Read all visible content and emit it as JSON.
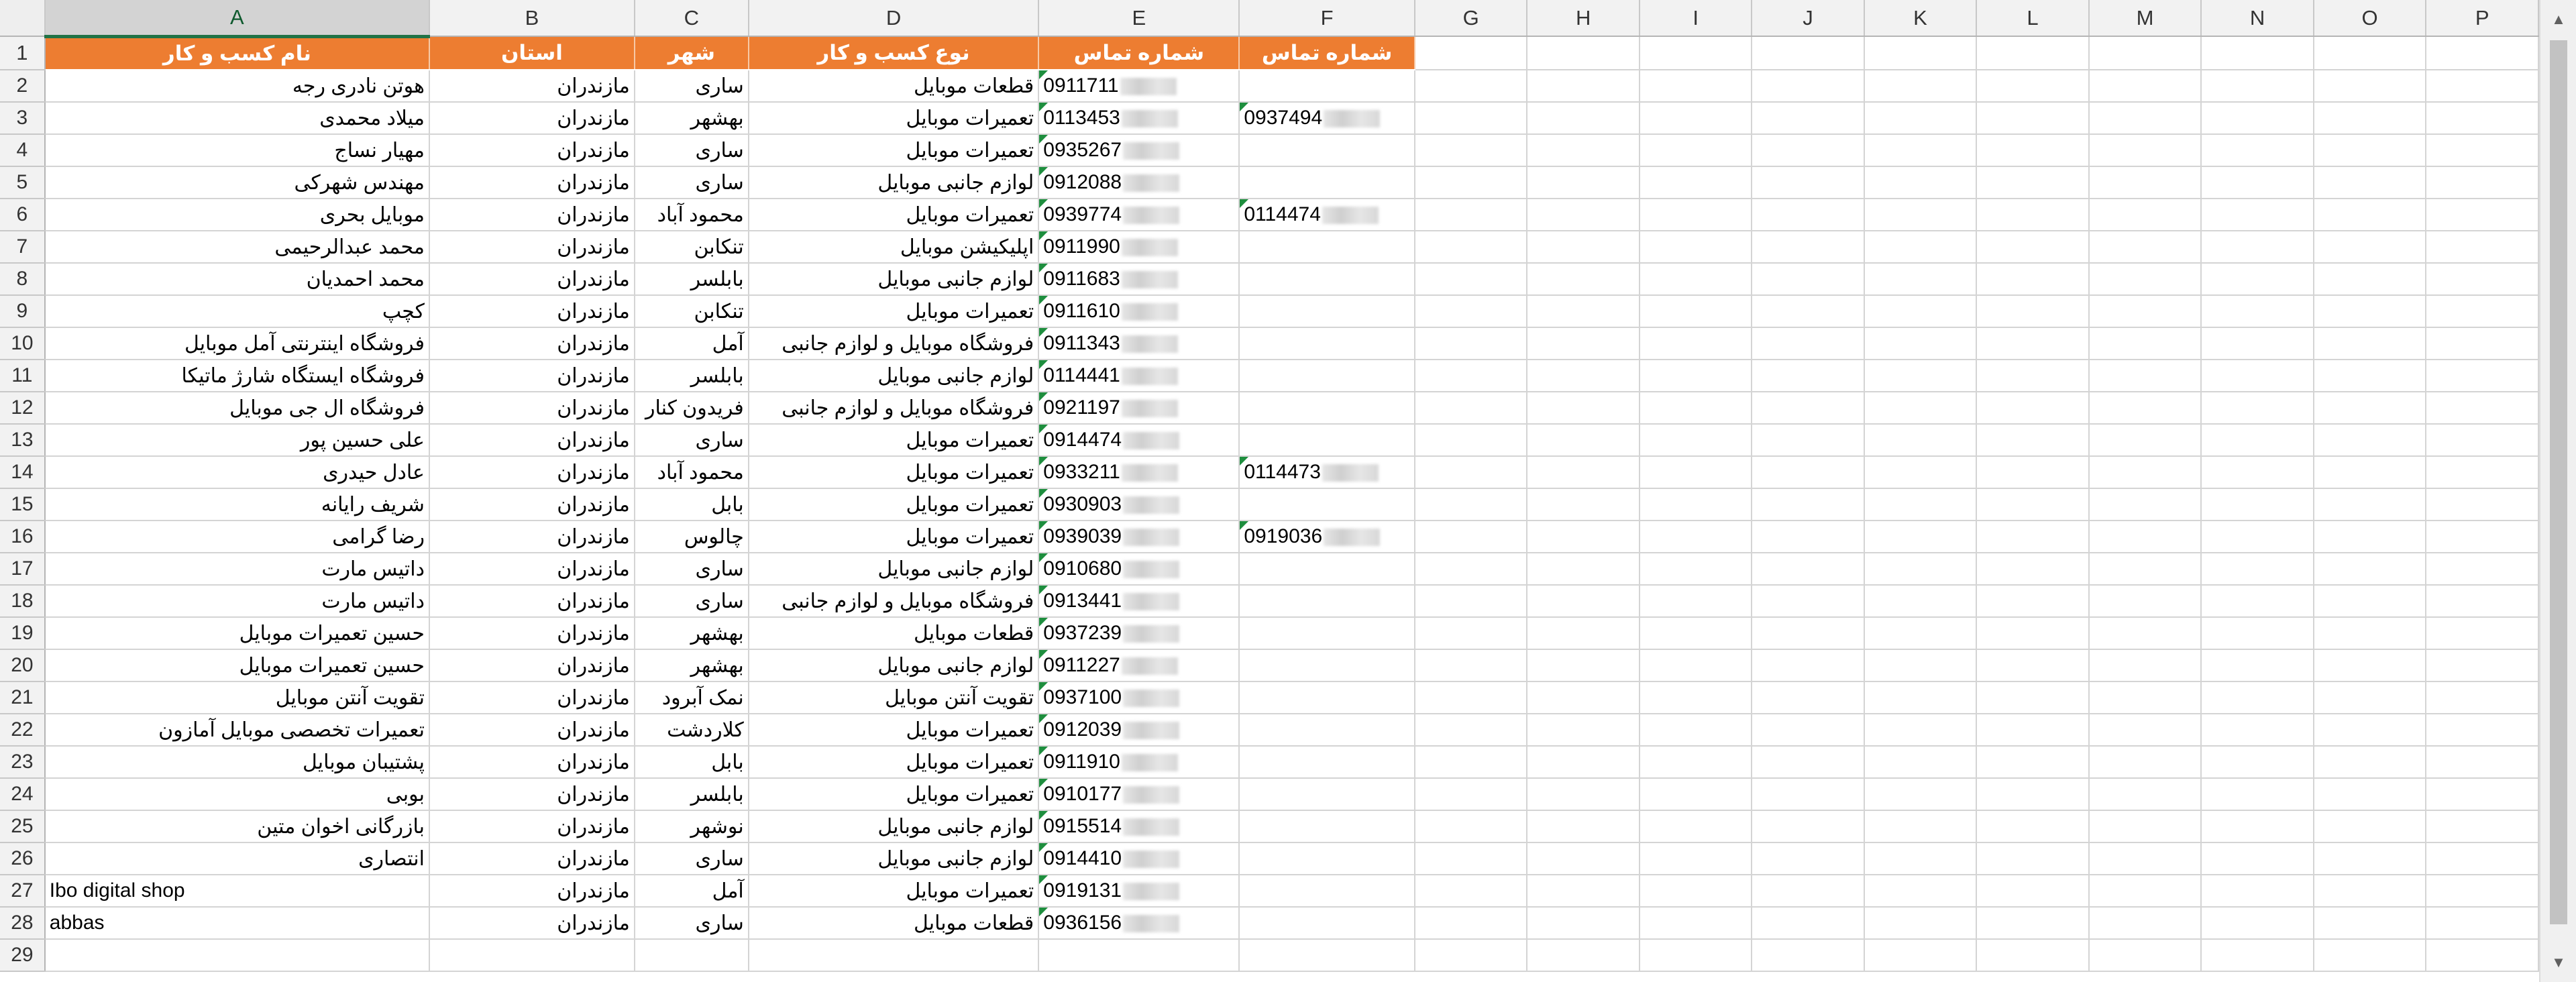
{
  "columns": [
    "A",
    "B",
    "C",
    "D",
    "E",
    "F",
    "G",
    "H",
    "I",
    "J",
    "K",
    "L",
    "M",
    "N",
    "O",
    "P"
  ],
  "selected_column": "A",
  "header_row": {
    "A": "نام کسب و کار",
    "B": "استان",
    "C": "شهر",
    "D": "نوع کسب و کار",
    "E": "شماره تماس",
    "F": "شماره تماس"
  },
  "rows": [
    {
      "n": "2",
      "name": "هوتن نادری رجه",
      "province": "مازندران",
      "city": "ساری",
      "type": "قطعات موبایل",
      "phone": "0911711",
      "phone2": ""
    },
    {
      "n": "3",
      "name": "میلاد محمدی",
      "province": "مازندران",
      "city": "بهشهر",
      "type": "تعمیرات موبایل",
      "phone": "0113453",
      "phone2": "0937494"
    },
    {
      "n": "4",
      "name": "مهیار نساج",
      "province": "مازندران",
      "city": "ساری",
      "type": "تعمیرات موبایل",
      "phone": "0935267",
      "phone2": ""
    },
    {
      "n": "5",
      "name": "مهندس شهرکی",
      "province": "مازندران",
      "city": "ساری",
      "type": "لوازم جانبی موبایل",
      "phone": "0912088",
      "phone2": ""
    },
    {
      "n": "6",
      "name": "موبایل بحری",
      "province": "مازندران",
      "city": "محمود آباد",
      "type": "تعمیرات موبایل",
      "phone": "0939774",
      "phone2": "0114474"
    },
    {
      "n": "7",
      "name": "محمد عبدالرحیمی",
      "province": "مازندران",
      "city": "تنکابن",
      "type": "اپلیکیشن موبایل",
      "phone": "0911990",
      "phone2": ""
    },
    {
      "n": "8",
      "name": "محمد احمدیان",
      "province": "مازندران",
      "city": "بابلسر",
      "type": "لوازم جانبی موبایل",
      "phone": "0911683",
      "phone2": ""
    },
    {
      "n": "9",
      "name": "کچپ",
      "province": "مازندران",
      "city": "تنکابن",
      "type": "تعمیرات موبایل",
      "phone": "0911610",
      "phone2": ""
    },
    {
      "n": "10",
      "name": "فروشگاه اینترنتی آمل موبایل",
      "province": "مازندران",
      "city": "آمل",
      "type": "فروشگاه موبایل و لوازم جانبی",
      "phone": "0911343",
      "phone2": ""
    },
    {
      "n": "11",
      "name": "فروشگاه ایستگاه شارژ ماتیکا",
      "province": "مازندران",
      "city": "بابلسر",
      "type": "لوازم جانبی موبایل",
      "phone": "0114441",
      "phone2": ""
    },
    {
      "n": "12",
      "name": "فروشگاه ال جی موبایل",
      "province": "مازندران",
      "city": "فریدون کنار",
      "type": "فروشگاه موبایل و لوازم جانبی",
      "phone": "0921197",
      "phone2": ""
    },
    {
      "n": "13",
      "name": "علی حسین پور",
      "province": "مازندران",
      "city": "ساری",
      "type": "تعمیرات موبایل",
      "phone": "0914474",
      "phone2": ""
    },
    {
      "n": "14",
      "name": "عادل حیدری",
      "province": "مازندران",
      "city": "محمود آباد",
      "type": "تعمیرات موبایل",
      "phone": "0933211",
      "phone2": "0114473"
    },
    {
      "n": "15",
      "name": "شریف رایانه",
      "province": "مازندران",
      "city": "بابل",
      "type": "تعمیرات موبایل",
      "phone": "0930903",
      "phone2": ""
    },
    {
      "n": "16",
      "name": "رضا گرامی",
      "province": "مازندران",
      "city": "چالوس",
      "type": "تعمیرات موبایل",
      "phone": "0939039",
      "phone2": "0919036"
    },
    {
      "n": "17",
      "name": "داتیس مارت",
      "province": "مازندران",
      "city": "ساری",
      "type": "لوازم جانبی موبایل",
      "phone": "0910680",
      "phone2": ""
    },
    {
      "n": "18",
      "name": "داتیس مارت",
      "province": "مازندران",
      "city": "ساری",
      "type": "فروشگاه موبایل و لوازم جانبی",
      "phone": "0913441",
      "phone2": ""
    },
    {
      "n": "19",
      "name": "حسین تعمیرات موبایل",
      "province": "مازندران",
      "city": "بهشهر",
      "type": "قطعات موبایل",
      "phone": "0937239",
      "phone2": ""
    },
    {
      "n": "20",
      "name": "حسین تعمیرات موبایل",
      "province": "مازندران",
      "city": "بهشهر",
      "type": "لوازم جانبی موبایل",
      "phone": "0911227",
      "phone2": ""
    },
    {
      "n": "21",
      "name": "تقویت آنتن موبایل",
      "province": "مازندران",
      "city": "نمک آبرود",
      "type": "تقویت آنتن موبایل",
      "phone": "0937100",
      "phone2": ""
    },
    {
      "n": "22",
      "name": "تعمیرات تخصصی موبایل آمازون",
      "province": "مازندران",
      "city": "کلاردشت",
      "type": "تعمیرات موبایل",
      "phone": "0912039",
      "phone2": ""
    },
    {
      "n": "23",
      "name": "پشتیبان موبایل",
      "province": "مازندران",
      "city": "بابل",
      "type": "تعمیرات موبایل",
      "phone": "0911910",
      "phone2": ""
    },
    {
      "n": "24",
      "name": "بوبی",
      "province": "مازندران",
      "city": "بابلسر",
      "type": "تعمیرات موبایل",
      "phone": "0910177",
      "phone2": ""
    },
    {
      "n": "25",
      "name": "بازرگانی اخوان متین",
      "province": "مازندران",
      "city": "نوشهر",
      "type": "لوازم جانبی موبایل",
      "phone": "0915514",
      "phone2": ""
    },
    {
      "n": "26",
      "name": "انتصاری",
      "province": "مازندران",
      "city": "ساری",
      "type": "لوازم جانبی موبایل",
      "phone": "0914410",
      "phone2": ""
    },
    {
      "n": "27",
      "name": "Ibo digital shop",
      "province": "مازندران",
      "city": "آمل",
      "type": "تعمیرات موبایل",
      "phone": "0919131",
      "phone2": ""
    },
    {
      "n": "28",
      "name": "abbas",
      "province": "مازندران",
      "city": "ساری",
      "type": "قطعات موبایل",
      "phone": "0936156",
      "phone2": ""
    },
    {
      "n": "29",
      "name": "",
      "province": "",
      "city": "",
      "type": "",
      "phone": "",
      "phone2": ""
    }
  ],
  "colors": {
    "header_fill": "#ed7d31",
    "header_text": "#ffffff",
    "selection": "#217346",
    "error_flag": "#1e8e3e"
  }
}
